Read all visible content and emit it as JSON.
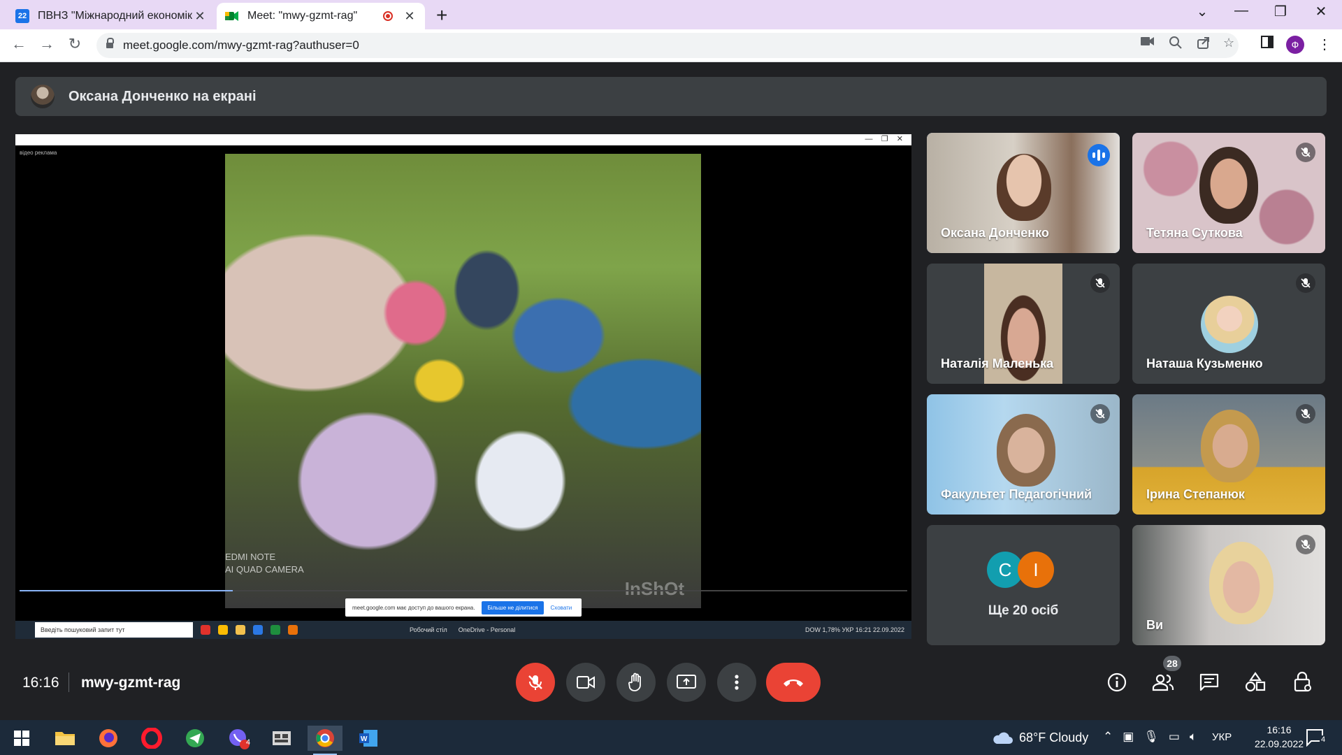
{
  "browser": {
    "tabs": [
      {
        "title": "ПВНЗ \"Міжнародний економіко",
        "favicon": "22",
        "active": false
      },
      {
        "title": "Meet: \"mwy-gzmt-rag\"",
        "favicon": "meet",
        "active": true
      }
    ],
    "new_tab": "+",
    "url": "meet.google.com/mwy-gzmt-rag?authuser=0",
    "profile_initial": "Ф"
  },
  "presenter": {
    "text": "Оксана Донченко на екрані"
  },
  "shared_screen": {
    "small_label": "відео реклама",
    "watermark": "InShOt",
    "camera_text_1": "EDMI NOTE",
    "camera_text_2": "AI QUAD CAMERA",
    "progress_fraction": 0.24,
    "share_note": "meet.google.com має доступ до вашого екрана.",
    "stop_sharing": "Більше не ділитися",
    "hide": "Сховати",
    "search_placeholder": "Введіть пошуковий запит тут",
    "desktop_label": "Робочий стіл",
    "onedrive": "OneDrive - Personal",
    "tray": "DOW  1,78%   УКР 16:21 22.09.2022"
  },
  "participants": [
    {
      "name": "Оксана Донченко",
      "speaking": true
    },
    {
      "name": "Тетяна Суткова",
      "muted": true
    },
    {
      "name": "Наталія Маленька",
      "muted": true
    },
    {
      "name": "Наташа Кузьменко",
      "muted": true
    },
    {
      "name": "Факультет Педагогічний",
      "muted": true
    },
    {
      "name": "Ірина Степанюк",
      "muted": true
    },
    {
      "name": "Ви",
      "muted": true
    }
  ],
  "more": {
    "initials": [
      "C",
      "I"
    ],
    "colors": [
      "#129eaf",
      "#e8710a"
    ],
    "label": "Ще 20 осіб"
  },
  "meeting": {
    "time": "16:16",
    "code": "mwy-gzmt-rag",
    "participant_count": "28"
  },
  "taskbar": {
    "weather": "68°F  Cloudy",
    "lang": "УКР",
    "time": "16:16",
    "date": "22.09.2022",
    "viber_badge": "4",
    "notif_count": "4"
  },
  "colors": {
    "accent": "#8ab4f8",
    "danger": "#ea4335",
    "surface": "#3c4043",
    "background": "#202124"
  }
}
